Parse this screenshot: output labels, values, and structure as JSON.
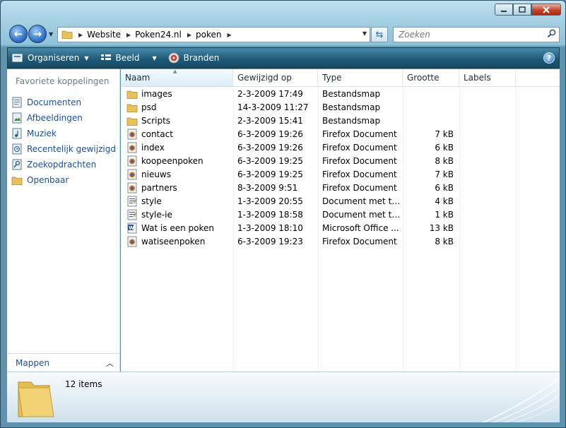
{
  "breadcrumb": [
    "Website",
    "Poken24.nl",
    "poken"
  ],
  "search": {
    "placeholder": "Zoeken"
  },
  "toolbar": {
    "organize": "Organiseren",
    "view": "Beeld",
    "burn": "Branden",
    "help": "?"
  },
  "sidebar": {
    "title": "Favoriete koppelingen",
    "items": [
      {
        "label": "Documenten",
        "icon": "documents-icon"
      },
      {
        "label": "Afbeeldingen",
        "icon": "pictures-icon"
      },
      {
        "label": "Muziek",
        "icon": "music-icon"
      },
      {
        "label": "Recentelijk gewijzigd",
        "icon": "recent-icon"
      },
      {
        "label": "Zoekopdrachten",
        "icon": "searches-icon"
      },
      {
        "label": "Openbaar",
        "icon": "folder-icon"
      }
    ],
    "folders_label": "Mappen"
  },
  "columns": {
    "name": "Naam",
    "date": "Gewijzigd op",
    "type": "Type",
    "size": "Grootte",
    "labels": "Labels"
  },
  "files": [
    {
      "name": "images",
      "date": "2-3-2009 17:49",
      "type": "Bestandsmap",
      "size": "",
      "icon": "folder"
    },
    {
      "name": "psd",
      "date": "14-3-2009 11:27",
      "type": "Bestandsmap",
      "size": "",
      "icon": "folder"
    },
    {
      "name": "Scripts",
      "date": "2-3-2009 15:41",
      "type": "Bestandsmap",
      "size": "",
      "icon": "folder"
    },
    {
      "name": "contact",
      "date": "6-3-2009 19:26",
      "type": "Firefox Document",
      "size": "7 kB",
      "icon": "firefox"
    },
    {
      "name": "index",
      "date": "6-3-2009 19:26",
      "type": "Firefox Document",
      "size": "6 kB",
      "icon": "firefox"
    },
    {
      "name": "koopeenpoken",
      "date": "6-3-2009 19:25",
      "type": "Firefox Document",
      "size": "8 kB",
      "icon": "firefox"
    },
    {
      "name": "nieuws",
      "date": "6-3-2009 19:25",
      "type": "Firefox Document",
      "size": "7 kB",
      "icon": "firefox"
    },
    {
      "name": "partners",
      "date": "8-3-2009 9:51",
      "type": "Firefox Document",
      "size": "6 kB",
      "icon": "firefox"
    },
    {
      "name": "style",
      "date": "1-3-2009 20:55",
      "type": "Document met tra...",
      "size": "4 kB",
      "icon": "css"
    },
    {
      "name": "style-ie",
      "date": "1-3-2009 18:58",
      "type": "Document met tra...",
      "size": "1 kB",
      "icon": "css"
    },
    {
      "name": "Wat is een poken",
      "date": "1-3-2009 18:10",
      "type": "Microsoft Office ...",
      "size": "13 kB",
      "icon": "word"
    },
    {
      "name": "watiseenpoken",
      "date": "6-3-2009 19:23",
      "type": "Firefox Document",
      "size": "8 kB",
      "icon": "firefox"
    }
  ],
  "details": {
    "count": "12 items"
  }
}
